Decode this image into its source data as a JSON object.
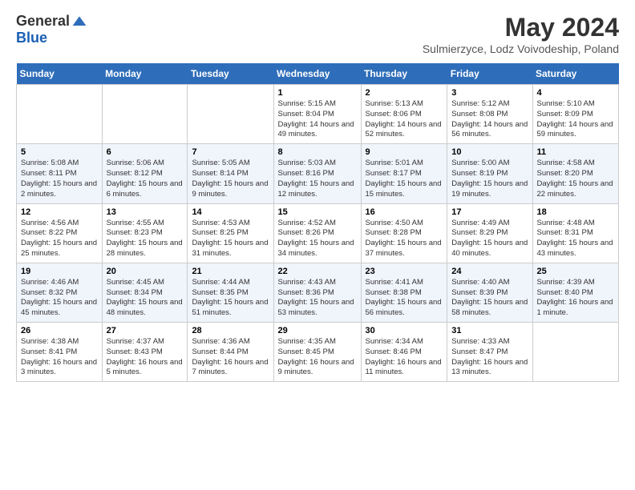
{
  "header": {
    "logo_general": "General",
    "logo_blue": "Blue",
    "month_title": "May 2024",
    "location": "Sulmierzyce, Lodz Voivodeship, Poland"
  },
  "columns": [
    "Sunday",
    "Monday",
    "Tuesday",
    "Wednesday",
    "Thursday",
    "Friday",
    "Saturday"
  ],
  "weeks": [
    {
      "days": [
        {
          "num": "",
          "info": ""
        },
        {
          "num": "",
          "info": ""
        },
        {
          "num": "",
          "info": ""
        },
        {
          "num": "1",
          "info": "Sunrise: 5:15 AM\nSunset: 8:04 PM\nDaylight: 14 hours and 49 minutes."
        },
        {
          "num": "2",
          "info": "Sunrise: 5:13 AM\nSunset: 8:06 PM\nDaylight: 14 hours and 52 minutes."
        },
        {
          "num": "3",
          "info": "Sunrise: 5:12 AM\nSunset: 8:08 PM\nDaylight: 14 hours and 56 minutes."
        },
        {
          "num": "4",
          "info": "Sunrise: 5:10 AM\nSunset: 8:09 PM\nDaylight: 14 hours and 59 minutes."
        }
      ]
    },
    {
      "days": [
        {
          "num": "5",
          "info": "Sunrise: 5:08 AM\nSunset: 8:11 PM\nDaylight: 15 hours and 2 minutes."
        },
        {
          "num": "6",
          "info": "Sunrise: 5:06 AM\nSunset: 8:12 PM\nDaylight: 15 hours and 6 minutes."
        },
        {
          "num": "7",
          "info": "Sunrise: 5:05 AM\nSunset: 8:14 PM\nDaylight: 15 hours and 9 minutes."
        },
        {
          "num": "8",
          "info": "Sunrise: 5:03 AM\nSunset: 8:16 PM\nDaylight: 15 hours and 12 minutes."
        },
        {
          "num": "9",
          "info": "Sunrise: 5:01 AM\nSunset: 8:17 PM\nDaylight: 15 hours and 15 minutes."
        },
        {
          "num": "10",
          "info": "Sunrise: 5:00 AM\nSunset: 8:19 PM\nDaylight: 15 hours and 19 minutes."
        },
        {
          "num": "11",
          "info": "Sunrise: 4:58 AM\nSunset: 8:20 PM\nDaylight: 15 hours and 22 minutes."
        }
      ]
    },
    {
      "days": [
        {
          "num": "12",
          "info": "Sunrise: 4:56 AM\nSunset: 8:22 PM\nDaylight: 15 hours and 25 minutes."
        },
        {
          "num": "13",
          "info": "Sunrise: 4:55 AM\nSunset: 8:23 PM\nDaylight: 15 hours and 28 minutes."
        },
        {
          "num": "14",
          "info": "Sunrise: 4:53 AM\nSunset: 8:25 PM\nDaylight: 15 hours and 31 minutes."
        },
        {
          "num": "15",
          "info": "Sunrise: 4:52 AM\nSunset: 8:26 PM\nDaylight: 15 hours and 34 minutes."
        },
        {
          "num": "16",
          "info": "Sunrise: 4:50 AM\nSunset: 8:28 PM\nDaylight: 15 hours and 37 minutes."
        },
        {
          "num": "17",
          "info": "Sunrise: 4:49 AM\nSunset: 8:29 PM\nDaylight: 15 hours and 40 minutes."
        },
        {
          "num": "18",
          "info": "Sunrise: 4:48 AM\nSunset: 8:31 PM\nDaylight: 15 hours and 43 minutes."
        }
      ]
    },
    {
      "days": [
        {
          "num": "19",
          "info": "Sunrise: 4:46 AM\nSunset: 8:32 PM\nDaylight: 15 hours and 45 minutes."
        },
        {
          "num": "20",
          "info": "Sunrise: 4:45 AM\nSunset: 8:34 PM\nDaylight: 15 hours and 48 minutes."
        },
        {
          "num": "21",
          "info": "Sunrise: 4:44 AM\nSunset: 8:35 PM\nDaylight: 15 hours and 51 minutes."
        },
        {
          "num": "22",
          "info": "Sunrise: 4:43 AM\nSunset: 8:36 PM\nDaylight: 15 hours and 53 minutes."
        },
        {
          "num": "23",
          "info": "Sunrise: 4:41 AM\nSunset: 8:38 PM\nDaylight: 15 hours and 56 minutes."
        },
        {
          "num": "24",
          "info": "Sunrise: 4:40 AM\nSunset: 8:39 PM\nDaylight: 15 hours and 58 minutes."
        },
        {
          "num": "25",
          "info": "Sunrise: 4:39 AM\nSunset: 8:40 PM\nDaylight: 16 hours and 1 minute."
        }
      ]
    },
    {
      "days": [
        {
          "num": "26",
          "info": "Sunrise: 4:38 AM\nSunset: 8:41 PM\nDaylight: 16 hours and 3 minutes."
        },
        {
          "num": "27",
          "info": "Sunrise: 4:37 AM\nSunset: 8:43 PM\nDaylight: 16 hours and 5 minutes."
        },
        {
          "num": "28",
          "info": "Sunrise: 4:36 AM\nSunset: 8:44 PM\nDaylight: 16 hours and 7 minutes."
        },
        {
          "num": "29",
          "info": "Sunrise: 4:35 AM\nSunset: 8:45 PM\nDaylight: 16 hours and 9 minutes."
        },
        {
          "num": "30",
          "info": "Sunrise: 4:34 AM\nSunset: 8:46 PM\nDaylight: 16 hours and 11 minutes."
        },
        {
          "num": "31",
          "info": "Sunrise: 4:33 AM\nSunset: 8:47 PM\nDaylight: 16 hours and 13 minutes."
        },
        {
          "num": "",
          "info": ""
        }
      ]
    }
  ]
}
